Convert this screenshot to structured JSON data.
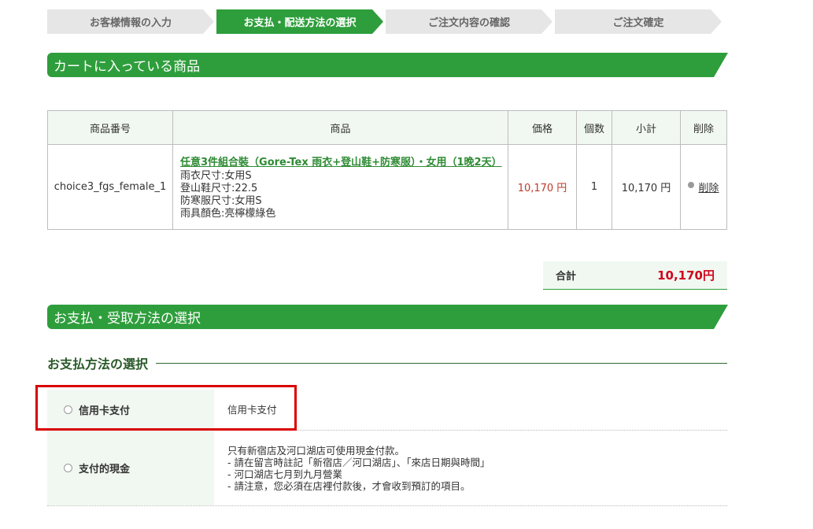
{
  "steps": [
    "お客様情報の入力",
    "お支払・配送方法の選択",
    "ご注文内容の確認",
    "ご注文確定"
  ],
  "cart_section": {
    "title": "カートに入っている商品"
  },
  "cart_table": {
    "headers": [
      "商品番号",
      "商品",
      "価格",
      "個数",
      "小計",
      "削除"
    ],
    "row": {
      "code": "choice3_fgs_female_1",
      "product_name": "任意3件組合裝（Gore-Tex 雨衣+登山鞋+防寒服）・女用（1晚2天）",
      "options": [
        "雨衣尺寸:女用S",
        "登山鞋尺寸:22.5",
        "防寒服尺寸:女用S",
        "雨具顏色:亮檸檬綠色"
      ],
      "price": "10,170 円",
      "qty": "1",
      "subtotal": "10,170 円",
      "delete_label": "削除"
    }
  },
  "total": {
    "label": "合計",
    "value": "10,170円"
  },
  "payment_section": {
    "title": "お支払・受取方法の選択"
  },
  "payment_method": {
    "heading": "お支払方法の選択",
    "options": [
      {
        "label": "信用卡支付",
        "description": [
          "信用卡支付"
        ]
      },
      {
        "label": "支付的現金",
        "description": [
          "只有新宿店及河口湖店可使用現金付款。",
          "- 請在留言時註記「新宿店／河口湖店」、「來店日期與時間」",
          "- 河口湖店七月到九月營業",
          "- 請注意，您必須在店裡付款後，才會收到預訂的項目。"
        ]
      }
    ]
  },
  "colors": {
    "accent": "#2e9e3c",
    "price": "#d0021b",
    "highlight": "#d90000"
  }
}
